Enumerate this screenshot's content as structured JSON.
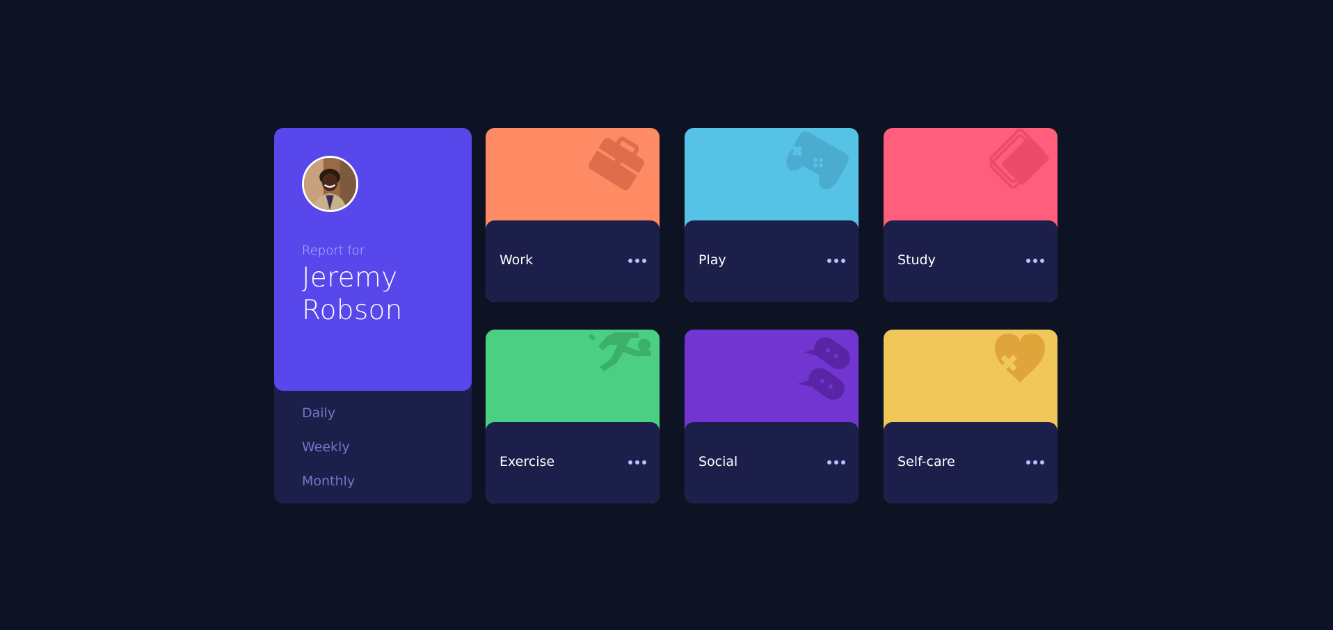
{
  "profile": {
    "report_for": "Report for",
    "name": "Jeremy Robson",
    "periods": [
      "Daily",
      "Weekly",
      "Monthly"
    ]
  },
  "activities": [
    {
      "title": "Work",
      "color": "#ff8b64",
      "icon": "briefcase-icon"
    },
    {
      "title": "Play",
      "color": "#55c2e6",
      "icon": "gamepad-icon"
    },
    {
      "title": "Study",
      "color": "#ff5e7d",
      "icon": "book-icon"
    },
    {
      "title": "Exercise",
      "color": "#4bcf82",
      "icon": "running-icon"
    },
    {
      "title": "Social",
      "color": "#7335d2",
      "icon": "chat-bubbles-icon"
    },
    {
      "title": "Self-care",
      "color": "#f1c75b",
      "icon": "heart-bandage-icon"
    }
  ],
  "colors": {
    "background": "#0e1323",
    "card_body": "#1c1f4a",
    "profile_accent": "#5847eb",
    "muted_text": "#7078c9",
    "pale_text": "#bbc0ff"
  }
}
